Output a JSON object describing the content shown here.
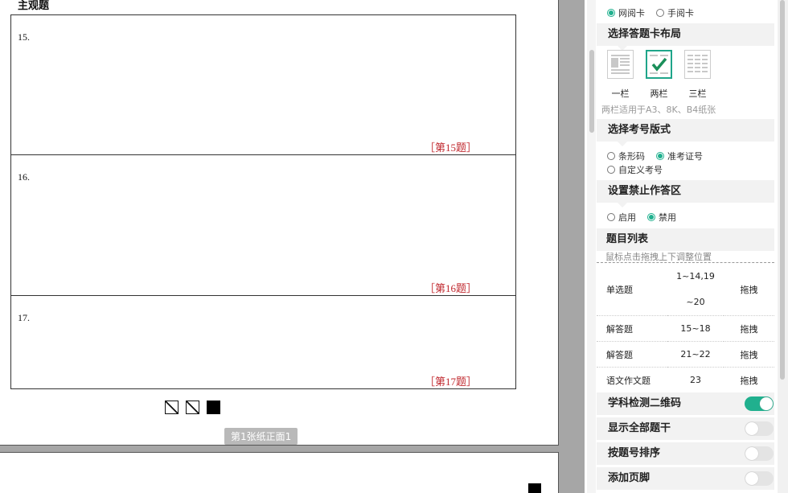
{
  "document": {
    "section_title": "主观题",
    "questions": [
      {
        "number": "15.",
        "label": "［第15题］"
      },
      {
        "number": "16.",
        "label": "［第16题］"
      },
      {
        "number": "17.",
        "label": "［第17题］"
      }
    ],
    "page_badge": "第1张纸正面1"
  },
  "panel": {
    "card_type": {
      "options": [
        "网阅卡",
        "手阅卡"
      ],
      "selected": "网阅卡"
    },
    "layout": {
      "title": "选择答题卡布局",
      "options": [
        "一栏",
        "两栏",
        "三栏"
      ],
      "selected": "两栏",
      "note": "两栏适用于A3、8K、B4纸张"
    },
    "exam_number": {
      "title": "选择考号版式",
      "options": [
        "条形码",
        "准考证号",
        "自定义考号"
      ],
      "selected": "准考证号"
    },
    "forbidden_zone": {
      "title": "设置禁止作答区",
      "options": [
        "启用",
        "禁用"
      ],
      "selected": "禁用"
    },
    "question_list": {
      "title": "题目列表",
      "hint": "鼠标点击拖拽上下调整位置",
      "rows": [
        {
          "type": "单选题",
          "range": "1~14,19~20",
          "action": "拖拽"
        },
        {
          "type": "解答题",
          "range": "15~18",
          "action": "拖拽"
        },
        {
          "type": "解答题",
          "range": "21~22",
          "action": "拖拽"
        },
        {
          "type": "语文作文题",
          "range": "23",
          "action": "拖拽"
        }
      ]
    },
    "toggles": [
      {
        "label": "学科检测二维码",
        "on": true
      },
      {
        "label": "显示全部题干",
        "on": false
      },
      {
        "label": "按题号排序",
        "on": false
      },
      {
        "label": "添加页脚",
        "on": false
      }
    ]
  },
  "colors": {
    "accent": "#20b08e",
    "label_red": "#c0282e"
  }
}
